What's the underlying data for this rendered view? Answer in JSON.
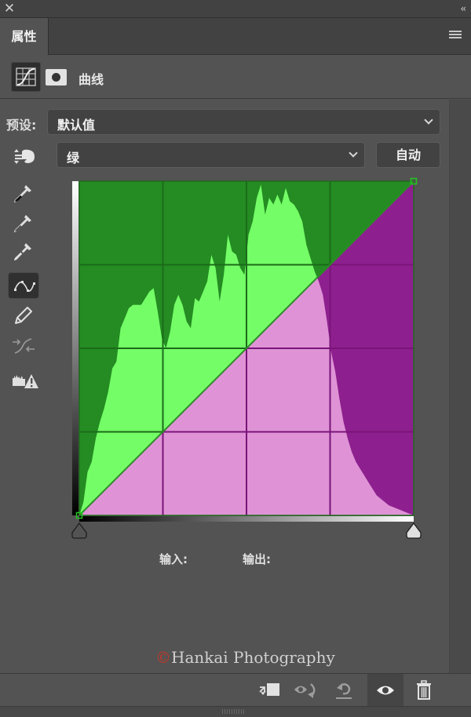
{
  "window": {
    "close_icon": "close-icon",
    "collapse_label": "‹‹"
  },
  "tabs": [
    {
      "label": "属性",
      "active": true
    }
  ],
  "panel_menu_icon": "hamburger-menu-icon",
  "adjustment": {
    "title": "曲线",
    "type_icon": "curves-adjustment-icon",
    "mask_icon": "layer-mask-icon"
  },
  "preset": {
    "label": "预设:",
    "value": "默认值"
  },
  "channel": {
    "value": "绿",
    "auto_label": "自动",
    "targeted_adjust_icon": "on-image-adjust-icon"
  },
  "tools": [
    {
      "name": "black-point-eyedropper-icon",
      "active": false
    },
    {
      "name": "gray-point-eyedropper-icon",
      "active": false
    },
    {
      "name": "white-point-eyedropper-icon",
      "active": false
    },
    {
      "name": "edit-points-curve-icon",
      "active": true
    },
    {
      "name": "pencil-draw-icon",
      "active": false
    },
    {
      "name": "smooth-curve-icon",
      "active": false,
      "disabled": true
    },
    {
      "name": "clipping-warning-icon",
      "active": false
    }
  ],
  "curve": {
    "channel_color": "#1fa81f",
    "points": [
      [
        0,
        0
      ],
      [
        255,
        255
      ]
    ],
    "colors": {
      "above_curve_bg": "#248c22",
      "above_curve_hist": "#74fd67",
      "below_curve_bg": "#8d208e",
      "below_curve_hist": "#df93d6",
      "grid_above": "#1b6b19",
      "grid_below": "#7a1479",
      "curve_line": "#2e8b2a",
      "endpoint": "#21c81f"
    },
    "histogram": [
      0.0,
      0.04,
      0.13,
      0.16,
      0.23,
      0.28,
      0.32,
      0.37,
      0.44,
      0.46,
      0.56,
      0.59,
      0.62,
      0.63,
      0.63,
      0.63,
      0.65,
      0.67,
      0.68,
      0.61,
      0.53,
      0.5,
      0.55,
      0.63,
      0.66,
      0.63,
      0.58,
      0.56,
      0.65,
      0.64,
      0.67,
      0.7,
      0.78,
      0.74,
      0.64,
      0.72,
      0.84,
      0.79,
      0.78,
      0.74,
      0.72,
      0.84,
      0.88,
      0.95,
      0.99,
      0.9,
      0.95,
      0.93,
      0.96,
      0.93,
      0.98,
      0.94,
      0.93,
      0.91,
      0.88,
      0.81,
      0.77,
      0.73,
      0.7,
      0.66,
      0.58,
      0.49,
      0.43,
      0.35,
      0.28,
      0.23,
      0.19,
      0.16,
      0.14,
      0.12,
      0.1,
      0.08,
      0.06,
      0.05,
      0.04,
      0.03,
      0.025,
      0.02,
      0.015,
      0.01,
      0.005,
      0.0
    ]
  },
  "io": {
    "input_label": "输入:",
    "output_label": "输出:"
  },
  "watermark": {
    "copyright": "©",
    "text": "Hankai Photography"
  },
  "bottom_toolbar": [
    {
      "name": "clip-to-layer-icon",
      "active": false
    },
    {
      "name": "view-previous-state-icon",
      "active": false
    },
    {
      "name": "reset-defaults-icon",
      "active": false
    },
    {
      "name": "toggle-visibility-icon",
      "active": true
    },
    {
      "name": "delete-icon",
      "active": false
    }
  ]
}
